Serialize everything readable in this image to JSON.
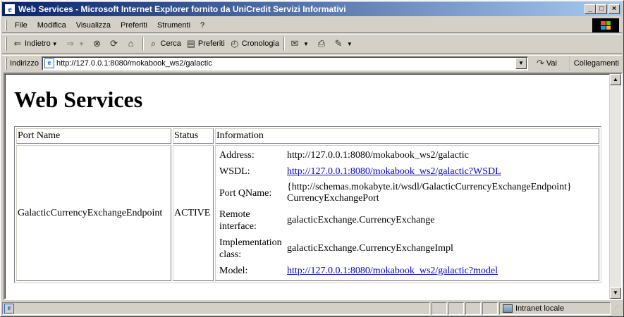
{
  "window": {
    "title": "Web Services - Microsoft Internet Explorer fornito da UniCredit Servizi Informativi",
    "minimize": "_",
    "maximize": "□",
    "close": "×"
  },
  "menu": [
    "File",
    "Modifica",
    "Visualizza",
    "Preferiti",
    "Strumenti",
    "?"
  ],
  "toolbar": {
    "back": "Indietro",
    "search": "Cerca",
    "favorites": "Preferiti",
    "history": "Cronologia"
  },
  "address": {
    "label": "Indirizzo",
    "url": "http://127.0.0.1:8080/mokabook_ws2/galactic",
    "go": "Vai",
    "links": "Collegamenti"
  },
  "page": {
    "heading": "Web Services",
    "table": {
      "headers": [
        "Port Name",
        "Status",
        "Information"
      ],
      "row": {
        "port_name": "GalacticCurrencyExchangeEndpoint",
        "status": "ACTIVE",
        "info": {
          "address_label": "Address:",
          "address_value": "http://127.0.0.1:8080/mokabook_ws2/galactic",
          "wsdl_label": "WSDL:",
          "wsdl_value": "http://127.0.0.1:8080/mokabook_ws2/galactic?WSDL",
          "qname_label": "Port QName:",
          "qname_value_1": "{http://schemas.mokabyte.it/wsdl/GalacticCurrencyExchangeEndpoint}",
          "qname_value_2": "CurrencyExchangePort",
          "remote_label_1": "Remote",
          "remote_label_2": "interface:",
          "remote_value": "galacticExchange.CurrencyExchange",
          "impl_label_1": "Implementation",
          "impl_label_2": "class:",
          "impl_value": "galacticExchange.CurrencyExchangeImpl",
          "model_label": "Model:",
          "model_value": "http://127.0.0.1:8080/mokabook_ws2/galactic?model"
        }
      }
    }
  },
  "status": {
    "zone": "Intranet locale"
  },
  "icons": [
    "ie-page-icon",
    "back-arrow-icon",
    "forward-arrow-icon",
    "stop-icon",
    "refresh-icon",
    "home-icon",
    "search-icon",
    "favorites-icon",
    "history-icon",
    "mail-icon",
    "print-icon",
    "edit-icon",
    "go-arrow-icon",
    "intranet-zone-icon",
    "windows-logo-icon"
  ]
}
